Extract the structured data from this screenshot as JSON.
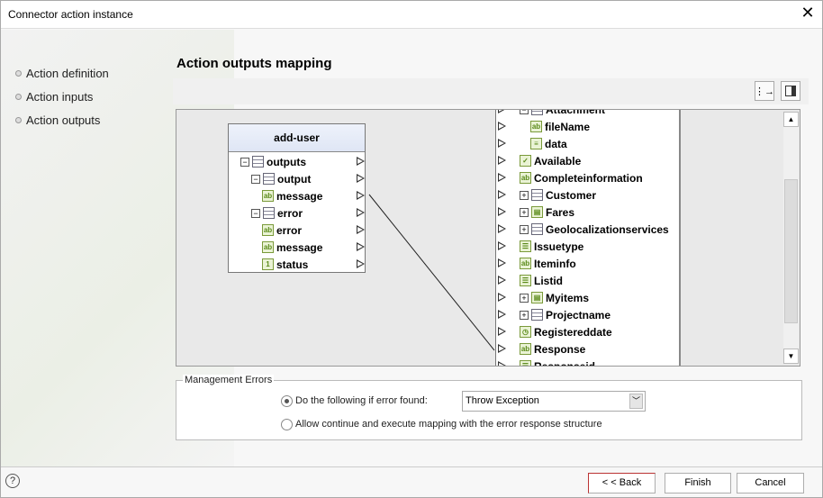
{
  "window": {
    "title": "Connector action instance",
    "close_icon": "close-icon"
  },
  "nav": {
    "items": [
      {
        "label": "Action definition"
      },
      {
        "label": "Action inputs"
      },
      {
        "label": "Action outputs"
      }
    ]
  },
  "main": {
    "heading": "Action outputs mapping"
  },
  "source_node": {
    "title": "add-user",
    "rows": [
      {
        "label": "outputs",
        "icon": "table",
        "level": 0,
        "expander": "minus"
      },
      {
        "label": "output",
        "icon": "table",
        "level": 1,
        "expander": "minus"
      },
      {
        "label": "message",
        "icon": "ab",
        "level": 2
      },
      {
        "label": "error",
        "icon": "table",
        "level": 1,
        "expander": "minus"
      },
      {
        "label": "error",
        "icon": "ab",
        "level": 2
      },
      {
        "label": "message",
        "icon": "ab",
        "level": 2
      },
      {
        "label": "status",
        "icon": "1",
        "level": 2
      }
    ]
  },
  "target_tree": {
    "rows": [
      {
        "label": "Attachment",
        "icon": "table",
        "level": 0,
        "expander": "minus"
      },
      {
        "label": "fileName",
        "icon": "ab",
        "level": 1
      },
      {
        "label": "data",
        "icon": "doc",
        "level": 1
      },
      {
        "label": "Available",
        "icon": "check",
        "level": 0
      },
      {
        "label": "Completeinformation",
        "icon": "ab",
        "level": 0
      },
      {
        "label": "Customer",
        "icon": "table",
        "level": 0,
        "expander": "plus"
      },
      {
        "label": "Fares",
        "icon": "list",
        "level": 0,
        "expander": "plus"
      },
      {
        "label": "Geolocalizationservices",
        "icon": "table",
        "level": 0,
        "expander": "plus"
      },
      {
        "label": "Issuetype",
        "icon": "enum",
        "level": 0
      },
      {
        "label": "Iteminfo",
        "icon": "ab",
        "level": 0
      },
      {
        "label": "Listid",
        "icon": "enum",
        "level": 0
      },
      {
        "label": "Myitems",
        "icon": "list",
        "level": 0,
        "expander": "plus"
      },
      {
        "label": "Projectname",
        "icon": "table",
        "level": 0,
        "expander": "plus"
      },
      {
        "label": "Registereddate",
        "icon": "date",
        "level": 0
      },
      {
        "label": "Response",
        "icon": "ab",
        "level": 0
      },
      {
        "label": "Responseid",
        "icon": "enum",
        "level": 0
      }
    ]
  },
  "mapping": [
    {
      "from": "message",
      "to": "Response"
    }
  ],
  "errors": {
    "group_label": "Management Errors",
    "option1": "Do the following if error found:",
    "option2": "Allow continue and execute mapping with the error response structure",
    "selected_option": 1,
    "action_value": "Throw Exception"
  },
  "footer": {
    "back": "< < Back",
    "finish": "Finish",
    "cancel": "Cancel",
    "help": "?"
  }
}
